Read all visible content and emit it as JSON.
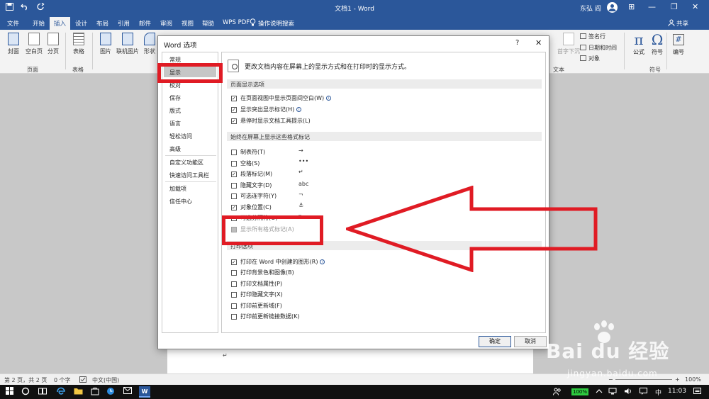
{
  "window": {
    "doc_title": "文档1 - Word",
    "user_name": "东弘 阎",
    "qat_icons": [
      "save-icon",
      "undo-icon",
      "redo-icon"
    ],
    "minimize_glyph": "—",
    "restore_glyph": "❐",
    "close_glyph": "✕",
    "ribbon_opts_glyph": "⊞"
  },
  "tabs": [
    {
      "label": "文件"
    },
    {
      "label": "开始"
    },
    {
      "label": "插入",
      "active": true
    },
    {
      "label": "设计"
    },
    {
      "label": "布局"
    },
    {
      "label": "引用"
    },
    {
      "label": "邮件"
    },
    {
      "label": "审阅"
    },
    {
      "label": "视图"
    },
    {
      "label": "帮助"
    },
    {
      "label": "WPS PDF"
    }
  ],
  "tell_me": "操作说明搜索",
  "share": "共享",
  "ribbon": {
    "cover": "封面",
    "blank_page": "空白页",
    "page_break": "分页",
    "group_pages": "页面",
    "table": "表格",
    "group_tables": "表格",
    "picture": "图片",
    "online_picture": "联机图片",
    "shapes": "形状",
    "signature_line": "签名行",
    "date_time": "日期和时间",
    "object": "对象",
    "group_text": "文本",
    "dropcap": "首字下沉",
    "equation": "公式",
    "symbol": "符号",
    "number": "编号",
    "group_symbols": "符号",
    "pi_glyph": "π",
    "omega_glyph": "Ω",
    "hash_glyph": "#"
  },
  "dialog": {
    "title": "Word 选项",
    "help": "?",
    "close": "✕",
    "nav": [
      {
        "label": "常规"
      },
      {
        "label": "显示",
        "selected": true
      },
      {
        "label": "校对"
      },
      {
        "label": "保存"
      },
      {
        "label": "版式"
      },
      {
        "label": "语言"
      },
      {
        "label": "轻松访问"
      },
      {
        "label": "高级"
      },
      {
        "label": "自定义功能区"
      },
      {
        "label": "快速访问工具栏"
      },
      {
        "label": "加载项"
      },
      {
        "label": "信任中心"
      }
    ],
    "header": "更改文档内容在屏幕上的显示方式和在打印时的显示方式。",
    "section_page": "页面显示选项",
    "page_options": [
      {
        "label": "在页面视图中显示页面间空白(W)",
        "checked": true,
        "info": true
      },
      {
        "label": "显示突出显示标记(H)",
        "checked": true,
        "info": true
      },
      {
        "label": "悬停时显示文档工具提示(L)",
        "checked": true,
        "info": false
      }
    ],
    "section_marks": "始终在屏幕上显示这些格式标记",
    "mark_options": [
      {
        "label": "制表符(T)",
        "checked": false,
        "symbol": "→"
      },
      {
        "label": "空格(S)",
        "checked": false,
        "symbol": "•••"
      },
      {
        "label": "段落标记(M)",
        "checked": true,
        "symbol": "↵"
      },
      {
        "label": "隐藏文字(D)",
        "checked": false,
        "symbol": "abc"
      },
      {
        "label": "可选连字符(Y)",
        "checked": false,
        "symbol": "¬"
      },
      {
        "label": "对象位置(C)",
        "checked": true,
        "symbol": "⚓"
      },
      {
        "label": "可选分隔符(O)",
        "checked": false,
        "symbol": "▯"
      },
      {
        "label": "显示所有格式标记(A)",
        "checked": false,
        "symbol": ""
      }
    ],
    "section_print": "打印选项",
    "print_options": [
      {
        "label": "打印在 Word 中创建的图形(R)",
        "checked": true,
        "info": true
      },
      {
        "label": "打印背景色和图像(B)",
        "checked": false,
        "info": false
      },
      {
        "label": "打印文档属性(P)",
        "checked": false,
        "info": false
      },
      {
        "label": "打印隐藏文字(X)",
        "checked": false,
        "info": false
      },
      {
        "label": "打印前更新域(F)",
        "checked": false,
        "info": false
      },
      {
        "label": "打印前更新链接数据(K)",
        "checked": false,
        "info": false
      }
    ],
    "ok": "确定",
    "cancel": "取消"
  },
  "status": {
    "page": "第 2 页，共 2 页",
    "words": "0 个字",
    "language": "中文(中国)",
    "zoom": "100%",
    "zoom_minus": "−",
    "zoom_plus": "+"
  },
  "taskbar": {
    "battery": "100%",
    "time": "11:03",
    "ime": "中",
    "word_letter": "W"
  },
  "watermark": {
    "brand": "Bai du 经验",
    "url": "jingyan.baidu.com"
  },
  "document": {
    "paragraph_mark": "↵"
  }
}
